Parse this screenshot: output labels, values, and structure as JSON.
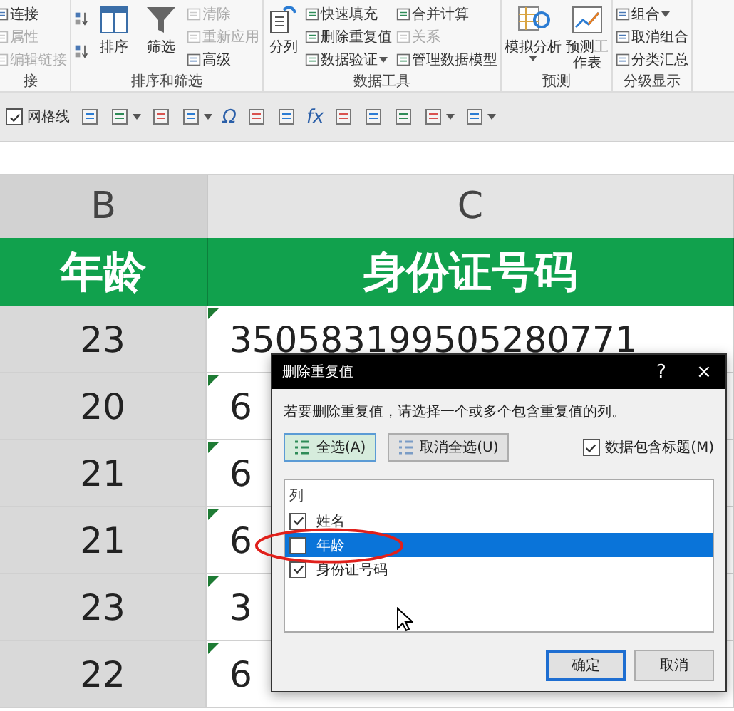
{
  "ribbon": {
    "groups": [
      {
        "label": "接",
        "columns": [
          [
            {
              "kind": "small",
              "label": "连接",
              "disabled": false
            },
            {
              "kind": "small",
              "label": "属性",
              "disabled": true
            },
            {
              "kind": "small",
              "label": "编辑链接",
              "disabled": true
            }
          ]
        ]
      },
      {
        "label": "排序和筛选",
        "columns": [
          [
            {
              "kind": "icon"
            },
            {
              "kind": "icon"
            }
          ],
          [
            {
              "kind": "large",
              "label": "排序",
              "dropdown": false
            }
          ],
          [
            {
              "kind": "large",
              "label": "筛选",
              "dropdown": false
            }
          ],
          [
            {
              "kind": "small",
              "label": "清除",
              "disabled": true
            },
            {
              "kind": "small",
              "label": "重新应用",
              "disabled": true
            },
            {
              "kind": "small",
              "label": "高级",
              "disabled": false
            }
          ]
        ]
      },
      {
        "label": "数据工具",
        "columns": [
          [
            {
              "kind": "large",
              "label": "分列",
              "dropdown": false
            }
          ],
          [
            {
              "kind": "small",
              "label": "快速填充",
              "disabled": false
            },
            {
              "kind": "small",
              "label": "删除重复值",
              "disabled": false
            },
            {
              "kind": "small",
              "label": "数据验证",
              "disabled": false,
              "dropdown": true
            }
          ],
          [
            {
              "kind": "small",
              "label": "合并计算",
              "disabled": false
            },
            {
              "kind": "small",
              "label": "关系",
              "disabled": true
            },
            {
              "kind": "small",
              "label": "管理数据模型",
              "disabled": false
            }
          ]
        ]
      },
      {
        "label": "预测",
        "columns": [
          [
            {
              "kind": "large",
              "label": "模拟分析",
              "dropdown": true
            }
          ],
          [
            {
              "kind": "large",
              "label": "预测工作表",
              "dropdown": false
            }
          ]
        ]
      },
      {
        "label": "分级显示",
        "columns": [
          [
            {
              "kind": "small",
              "label": "组合",
              "disabled": false,
              "dropdown": true
            },
            {
              "kind": "small",
              "label": "取消组合",
              "disabled": false
            },
            {
              "kind": "small",
              "label": "分类汇总",
              "disabled": false
            }
          ]
        ]
      }
    ]
  },
  "toolbar": {
    "items": [
      {
        "kind": "checkbox",
        "label": "网格线",
        "checked": true
      },
      {
        "kind": "icon",
        "dropdown": false
      },
      {
        "kind": "icon",
        "dropdown": true
      },
      {
        "kind": "icon",
        "dropdown": false
      },
      {
        "kind": "icon",
        "dropdown": true
      },
      {
        "kind": "glyph",
        "text": "Ω"
      },
      {
        "kind": "icon",
        "dropdown": false
      },
      {
        "kind": "icon",
        "dropdown": false
      },
      {
        "kind": "glyph",
        "text": "fx"
      },
      {
        "kind": "icon",
        "dropdown": false
      },
      {
        "kind": "icon",
        "dropdown": false
      },
      {
        "kind": "icon",
        "dropdown": false
      },
      {
        "kind": "icon",
        "dropdown": true
      },
      {
        "kind": "icon",
        "dropdown": true
      }
    ]
  },
  "sheet": {
    "columns": [
      {
        "letter": "B",
        "selected": true
      },
      {
        "letter": "C",
        "selected": false
      }
    ],
    "header": [
      "年龄",
      "身份证号码"
    ],
    "rows": [
      {
        "cells": [
          "23",
          "350583199505280771"
        ],
        "error_flag": true
      },
      {
        "cells": [
          "20",
          "6"
        ],
        "error_flag": true
      },
      {
        "cells": [
          "21",
          "6"
        ],
        "error_flag": true
      },
      {
        "cells": [
          "21",
          "6"
        ],
        "error_flag": true
      },
      {
        "cells": [
          "23",
          "3"
        ],
        "error_flag": true
      },
      {
        "cells": [
          "22",
          "6"
        ],
        "error_flag": true
      }
    ]
  },
  "dialog": {
    "title": "删除重复值",
    "help": "?",
    "close": "×",
    "description": "若要删除重复值，请选择一个或多个包含重复值的列。",
    "buttons": [
      {
        "label": "全选(A)",
        "focused": true
      },
      {
        "label": "取消全选(U)",
        "focused": false
      }
    ],
    "header_checkbox": {
      "label": "数据包含标题(M)",
      "checked": true
    },
    "list": {
      "heading": "列",
      "items": [
        {
          "label": "姓名",
          "checked": true,
          "selected": false
        },
        {
          "label": "年龄",
          "checked": false,
          "selected": true
        },
        {
          "label": "身份证号码",
          "checked": true,
          "selected": false
        }
      ]
    },
    "footer": [
      {
        "label": "确定",
        "default": true
      },
      {
        "label": "取消",
        "default": false
      }
    ]
  }
}
